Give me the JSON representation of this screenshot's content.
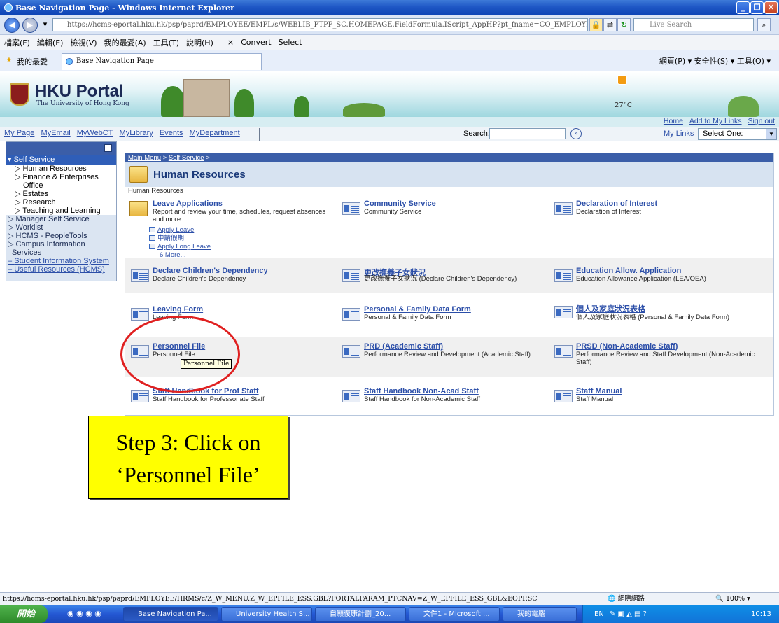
{
  "window": {
    "title": "Base Navigation Page - Windows Internet Explorer"
  },
  "address": {
    "url": "https://hcms-eportal.hku.hk/psp/paprd/EMPLOYEE/EMPL/s/WEBLIB_PTPP_SC.HOMEPAGE.FieldFormula.IScript_AppHP?pt_fname=CO_EMPLOYEE_SE",
    "search_placeholder": "Live Search"
  },
  "menubar": [
    "檔案(F)",
    "編輯(E)",
    "檢視(V)",
    "我的最愛(A)",
    "工具(T)",
    "說明(H)",
    "Convert",
    "Select"
  ],
  "favorites": {
    "label": "我的最愛",
    "tab_title": "Base Navigation Page",
    "cmd": "網頁(P) ▾   安全性(S) ▾   工具(O) ▾"
  },
  "portal": {
    "title": "HKU Portal",
    "subtitle": "The University of Hong Kong",
    "temp": "27°C",
    "toplinks": [
      "Home",
      "Add to My Links",
      "Sign out"
    ],
    "tabs": [
      "My Page",
      "MyEmail",
      "MyWebCT",
      "MyLibrary",
      "Events",
      "MyDepartment"
    ],
    "search_label": "Search:",
    "mylinks_label": "My Links",
    "mylinks_value": "Select One:"
  },
  "leftmenu": {
    "selected": "Self Service",
    "sub": [
      "Human Resources",
      "Finance & Enterprises",
      "Office",
      "Estates",
      "Research",
      "Teaching and Learning"
    ],
    "top": [
      "Manager Self Service",
      "Worklist",
      "HCMS - PeopleTools",
      "Campus Information",
      "Services"
    ],
    "links": [
      "Student Information System",
      "Useful Resources (HCMS)"
    ]
  },
  "content": {
    "crumb_main": "Main Menu",
    "crumb_sep": " > ",
    "crumb_self": "Self Service",
    "crumb_end": " >",
    "page_title": "Human Resources",
    "subhead": "Human Resources",
    "leave": {
      "title": "Leave Applications",
      "desc1": "Report and review your time, schedules, request absences",
      "desc2": "and more.",
      "links": [
        "Apply Leave",
        "申請假期",
        "Apply Long Leave"
      ],
      "more": "6 More..."
    },
    "items": [
      {
        "title": "Community Service",
        "desc": "Community Service"
      },
      {
        "title": "Declaration of Interest",
        "desc": "Declaration of Interest"
      },
      {
        "title": "Declare Children's Dependency",
        "desc": "Declare Children's Dependency"
      },
      {
        "title": "更改撫養子女狀況",
        "desc": "更改撫養子女狀況 (Declare Children's Dependency)"
      },
      {
        "title": "Education Allow. Application",
        "desc": "Education Allowance Application (LEA/OEA)"
      },
      {
        "title": "Leaving Form",
        "desc": "Leaving Form"
      },
      {
        "title": "Personal & Family Data Form",
        "desc": "Personal & Family Data Form"
      },
      {
        "title": "個人及家庭狀況表格",
        "desc": "個人及家庭狀況表格 (Personal & Family Data Form)"
      },
      {
        "title": "Personnel File",
        "desc": "Personnel File"
      },
      {
        "title": "PRD (Academic Staff)",
        "desc": "Performance Review and Development (Academic Staff)"
      },
      {
        "title": "PRSD (Non-Academic Staff)",
        "desc": "Performance Review and Staff Development (Non-Academic Staff)"
      },
      {
        "title": "Staff Handbook for Prof Staff",
        "desc": "Staff Handbook for Professoriate Staff"
      },
      {
        "title": "Staff Handbook Non-Acad Staff",
        "desc": "Staff Handbook for Non-Academic Staff"
      },
      {
        "title": "Staff Manual",
        "desc": "Staff Manual"
      }
    ]
  },
  "tooltip": "Personnel File",
  "callout": {
    "line1": "Step 3: Click on",
    "line2": "‘Personnel File’"
  },
  "status": {
    "url": "https://hcms-eportal.hku.hk/psp/paprd/EMPLOYEE/HRMS/c/Z_W_MENU.Z_W_EPFILE_ESS.GBL?PORTALPARAM_PTCNAV=Z_W_EPFILE_ESS_GBL&EOPP.SC",
    "zone": "網際網路",
    "zoom": "100%"
  },
  "taskbar": {
    "start": "開始",
    "tasks": [
      "Base Navigation Pa...",
      "University Health S...",
      "自願復康計劃_20...",
      "文件1 - Microsoft ...",
      "我的電腦"
    ],
    "lang": "EN",
    "time": "10:13"
  }
}
